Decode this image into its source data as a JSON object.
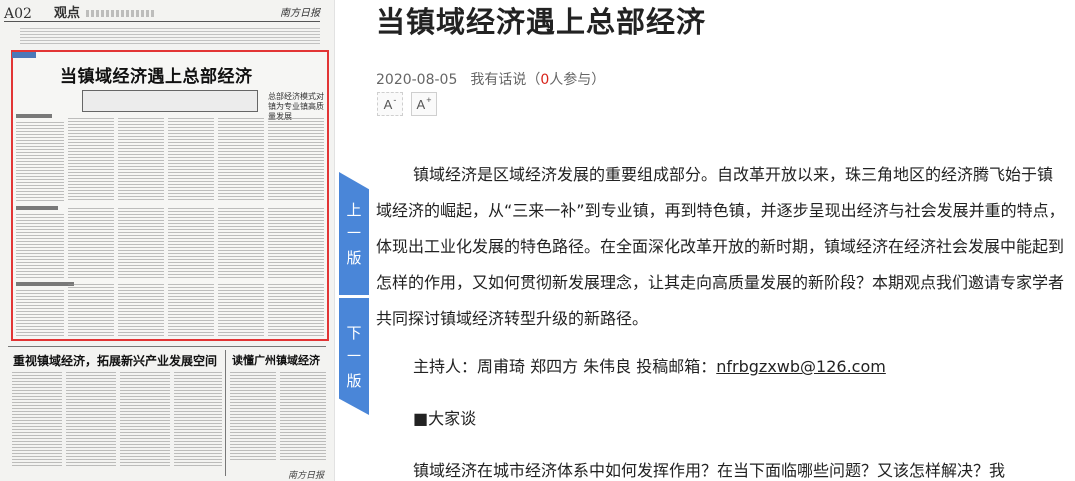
{
  "newspaper": {
    "page_no": "A02",
    "section": "观点",
    "masthead": "南方日报",
    "feature_title": "当镇域经济遇上总部经济",
    "feature_side": "总部经济模式对镇为专业镇高质量发展",
    "bottom_title_left": "重视镇域经济，拓展新兴产业发展空间",
    "bottom_title_right": "读懂广州镇域经济"
  },
  "page_tabs": {
    "prev": [
      "上",
      "一",
      "版"
    ],
    "next": [
      "下",
      "一",
      "版"
    ]
  },
  "article": {
    "title": "当镇域经济遇上总部经济",
    "date": "2020-08-05",
    "comment_prefix": "我有话说（",
    "comment_count": "0",
    "comment_suffix": "人参与）",
    "font_decrease_label": "A",
    "font_decrease_sup": "-",
    "font_increase_label": "A",
    "font_increase_sup": "+",
    "paragraph_1": "镇域经济是区域经济发展的重要组成部分。自改革开放以来，珠三角地区的经济腾飞始于镇域经济的崛起，从“三来一补”到专业镇，再到特色镇，并逐步呈现出经济与社会发展并重的特点，体现出工业化发展的特色路径。在全面深化改革开放的新时期，镇域经济在经济社会发展中能起到怎样的作用，又如何贯彻新发展理念，让其走向高质量发展的新阶段？本期观点我们邀请专家学者共同探讨镇域经济转型升级的新路径。",
    "hosts_label": "主持人：周甫琦 郑四方 朱伟良 投稿邮箱：",
    "email": "nfrbgzxwb@126.com",
    "section_marker": "■大家谈",
    "paragraph_3": "镇域经济在城市经济体系中如何发挥作用？在当下面临哪些问题？又该怎样解决？我"
  }
}
